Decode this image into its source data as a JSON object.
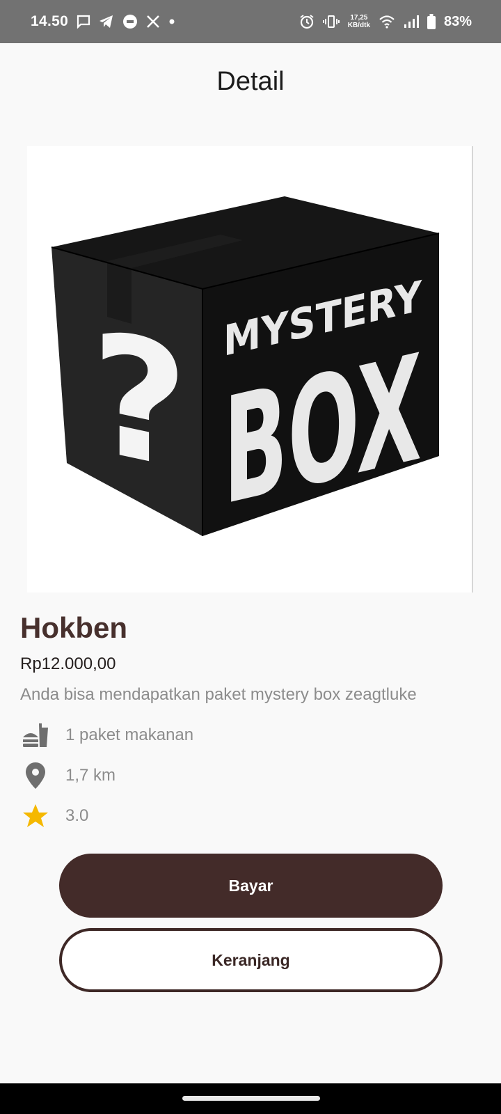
{
  "status_bar": {
    "time": "14.50",
    "net_speed_value": "17,25",
    "net_speed_unit": "KB/dtk",
    "battery": "83%",
    "icons": [
      "message-icon",
      "telegram-icon",
      "messenger-icon",
      "x-icon",
      "dot-icon",
      "alarm-icon",
      "vibrate-icon",
      "wifi-icon",
      "signal-icon",
      "battery-icon"
    ]
  },
  "header": {
    "title": "Detail"
  },
  "product": {
    "image_text_line1": "MYSTERY",
    "image_text_line2": "BOX",
    "image_symbol": "?",
    "name": "Hokben",
    "price": "Rp12.000,00",
    "description": "Anda bisa mendapatkan paket mystery box zeagtluke",
    "details": [
      {
        "icon": "fastfood-icon",
        "text": "1 paket makanan"
      },
      {
        "icon": "location-pin-icon",
        "text": "1,7 km"
      },
      {
        "icon": "star-icon",
        "text": "3.0"
      }
    ]
  },
  "actions": {
    "pay_label": "Bayar",
    "cart_label": "Keranjang"
  },
  "colors": {
    "accent": "#432b29",
    "title_brown": "#47302d",
    "star": "#f5b800",
    "status_bar": "#727272"
  }
}
